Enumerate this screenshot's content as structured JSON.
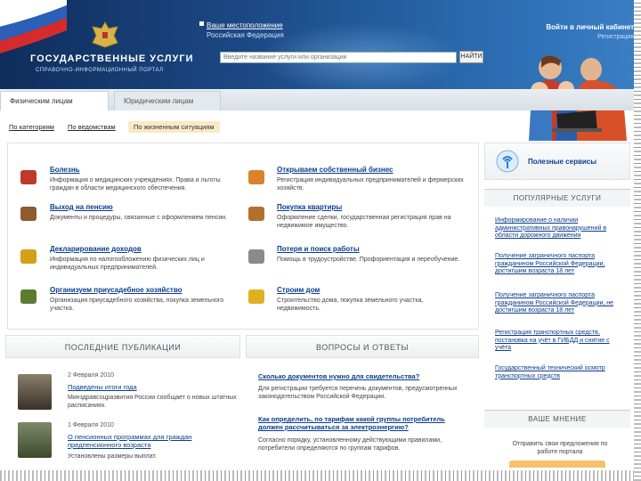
{
  "header": {
    "logo_title": "ГОСУДАРСТВЕННЫЕ УСЛУГИ",
    "logo_subtitle": "СПРАВОЧНО-ИНФОРМАЦИОННЫЙ ПОРТАЛ",
    "location_label": "Ваше местоположение",
    "location_value": "Российская Федерация",
    "search_placeholder": "Введите название услуги или организации",
    "search_button": "НАЙТИ",
    "login_link": "Войти в личный кабинет",
    "register_link": "Регистрация"
  },
  "tabs": {
    "individuals": "Физическим лицам",
    "legal": "Юридическим лицам"
  },
  "subnav": {
    "by_category": "По категориям",
    "by_department": "По ведомствам",
    "by_situation": "По жизненным ситуациям"
  },
  "services": [
    {
      "title": "Болезнь",
      "desc": "Информация о медицинских учреждениях. Права и льготы граждан в области медицинского обеспечения.",
      "color": "#c0392b"
    },
    {
      "title": "Открываем собственный бизнес",
      "desc": "Регистрация индивидуальных предпринимателей и фермерских хозяйств.",
      "color": "#d9822b"
    },
    {
      "title": "Выход на пенсию",
      "desc": "Документы и процедуры, связанные с оформлением пенсии.",
      "color": "#8e5a2e"
    },
    {
      "title": "Покупка квартиры",
      "desc": "Оформление сделки, государственная регистрация прав на недвижимое имущество.",
      "color": "#b3702d"
    },
    {
      "title": "Декларирование доходов",
      "desc": "Информация по налогообложению физических лиц и индивидуальных предпринимателей.",
      "color": "#d4a017"
    },
    {
      "title": "Потеря и поиск работы",
      "desc": "Помощь в трудоустройстве. Профориентация и переобучение.",
      "color": "#8a8a8a"
    },
    {
      "title": "Организуем приусадебное хозяйство",
      "desc": "Организация приусадебного хозяйства, покупка земельного участка.",
      "color": "#5a7d2e"
    },
    {
      "title": "Строим дом",
      "desc": "Строительство дома, покупка земельного участка, недвижимость.",
      "color": "#e0b020"
    }
  ],
  "sidebar": {
    "quick_services": "Полезные сервисы",
    "popular_head": "ПОПУЛЯРНЫЕ УСЛУГИ",
    "popular": [
      "Информирование о наличии административных правонарушений в области дорожного движения",
      "Получение заграничного паспорта гражданином Российской Федерации, достигшим возраста 18 лет",
      "Получение заграничного паспорта гражданином Российской Федерации, не достигшим возраста 18 лет",
      "Регистрация транспортных средств, постановка на учёт в ГИБДД и снятие с учёта",
      "Государственный технический осмотр транспортных средств"
    ],
    "opinion_head": "ВАШЕ МНЕНИЕ",
    "opinion_text": "Отправить свои предложения по работе портала"
  },
  "bottom": {
    "publications_head": "ПОСЛЕДНИЕ ПУБЛИКАЦИИ",
    "qa_head": "ВОПРОСЫ И ОТВЕТЫ",
    "publications": [
      {
        "date": "2 Февраля 2010",
        "title": "Подведены итоги года",
        "desc": "Минздравсоцразвития России сообщает о новых штатных расписаниях."
      },
      {
        "date": "1 Февраля 2010",
        "title": "О пенсионных программах для граждан предпенсионного возраста",
        "desc": "Установлены размеры выплат."
      }
    ],
    "qa": [
      {
        "q": "Сколько документов нужно для свидетельства?",
        "a": "Для регистрации требуется перечень документов, предусмотренных законодательством Российской Федерации."
      },
      {
        "q": "Как определить, по тарифам какой группы потребитель должен рассчитываться за электроэнергию?",
        "a": "Согласно порядку, установленному действующими правилами, потребители определяются по группам тарифов."
      }
    ]
  }
}
